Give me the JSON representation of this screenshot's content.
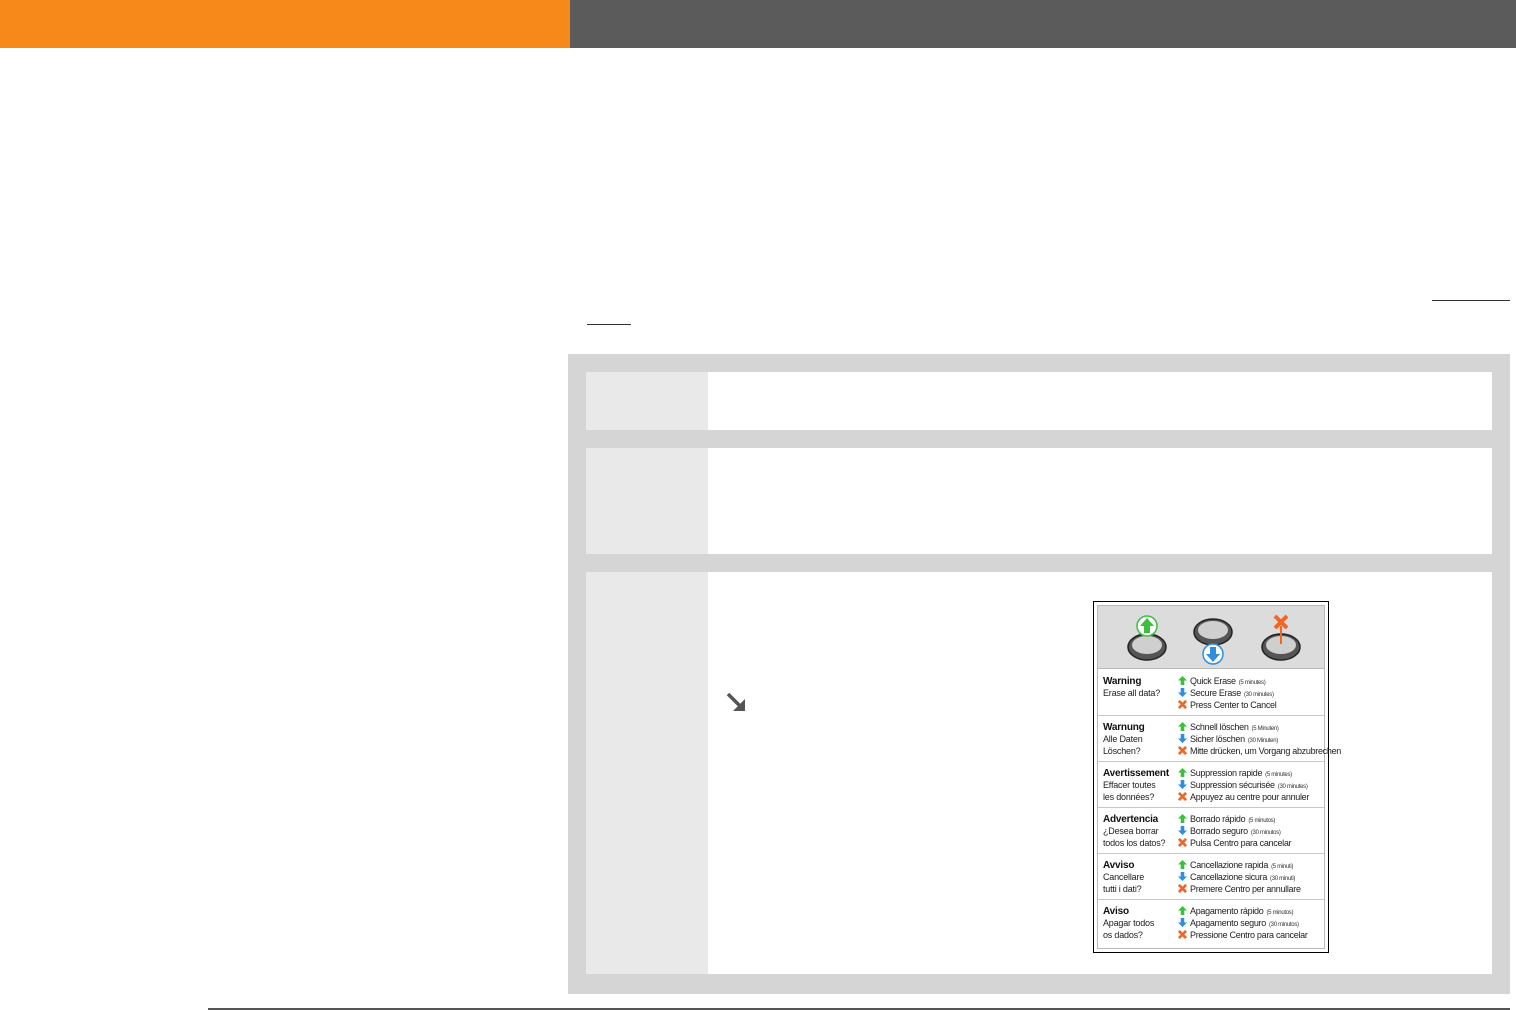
{
  "header": {
    "left_color": "#f7891b",
    "right_color": "#5b5b5b"
  },
  "device_screen": {
    "languages": [
      {
        "title": "Warning",
        "question_line1": "Erase all data?",
        "question_line2": "",
        "quick": "Quick Erase",
        "quick_time": "(5 minutes)",
        "secure": "Secure Erase",
        "secure_time": "(30 minutes)",
        "cancel": "Press Center to Cancel"
      },
      {
        "title": "Warnung",
        "question_line1": "Alle Daten",
        "question_line2": "Löschen?",
        "quick": "Schnell löschen",
        "quick_time": "(5 Minuten)",
        "secure": "Sicher löschen",
        "secure_time": "(30 Minuten)",
        "cancel": "Mitte drücken, um Vorgang abzubrechen"
      },
      {
        "title": "Avertissement",
        "question_line1": "Effacer toutes",
        "question_line2": "les données?",
        "quick": "Suppression rapide",
        "quick_time": "(5 minutes)",
        "secure": "Suppression sécurisée",
        "secure_time": "(30 minutes)",
        "cancel": "Appuyez au centre pour annuler"
      },
      {
        "title": "Advertencia",
        "question_line1": "¿Desea borrar",
        "question_line2": "todos los datos?",
        "quick": "Borrado rápido",
        "quick_time": "(5 minutos)",
        "secure": "Borrado seguro",
        "secure_time": "(30 minutos)",
        "cancel": "Pulsa Centro para cancelar"
      },
      {
        "title": "Avviso",
        "question_line1": "Cancellare",
        "question_line2": "tutti i dati?",
        "quick": "Cancellazione rapida",
        "quick_time": "(5 minuti)",
        "secure": "Cancellazione sicura",
        "secure_time": "(30 minuti)",
        "cancel": "Premere Centro per annullare"
      },
      {
        "title": "Aviso",
        "question_line1": "Apagar todos",
        "question_line2": "os dados?",
        "quick": "Apagamento rápido",
        "quick_time": "(5 minutos)",
        "secure": "Apagamento seguro",
        "secure_time": "(30 minutos)",
        "cancel": "Pressione Centro para cancelar"
      }
    ],
    "icons": {
      "quick": "green-up-arrow-icon",
      "secure": "blue-down-arrow-icon",
      "cancel": "orange-x-icon"
    },
    "colors": {
      "quick": "#3cbf3c",
      "secure": "#2f8fde",
      "cancel": "#f26522"
    }
  }
}
